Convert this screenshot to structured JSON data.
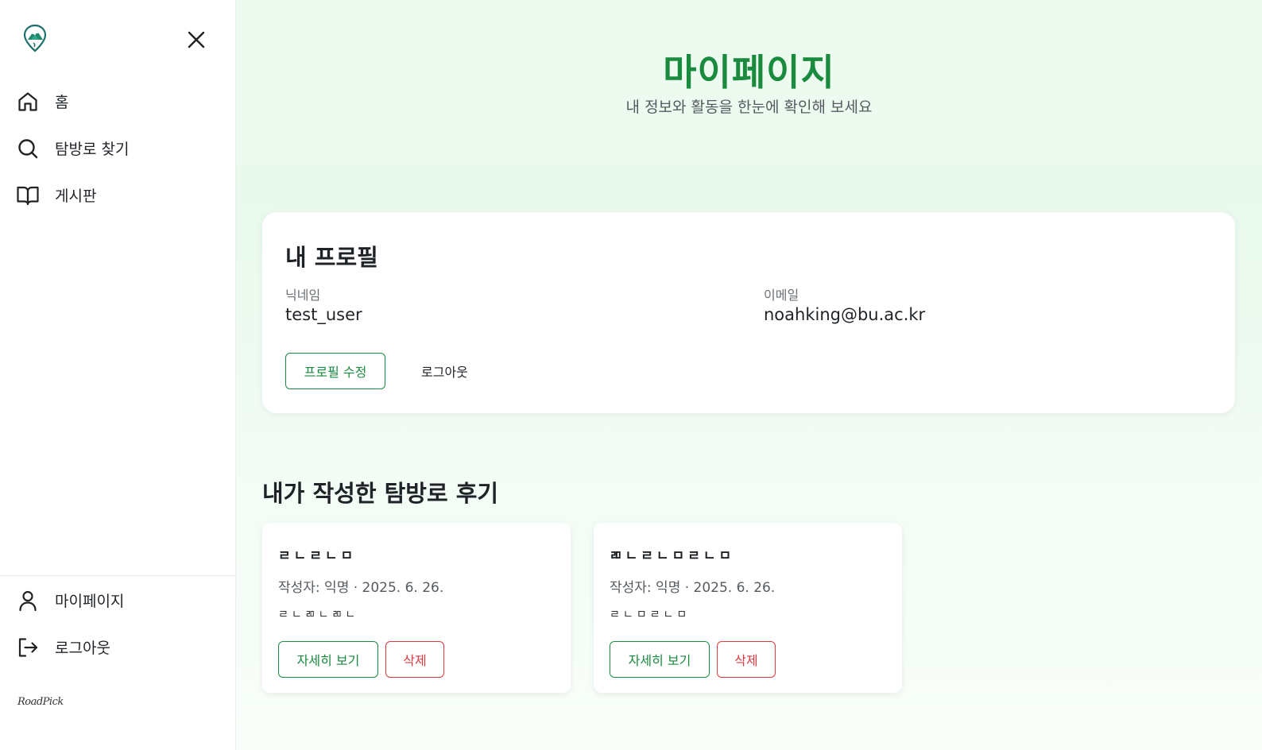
{
  "colors": {
    "accent": "#1a8a3f",
    "danger": "#e0393e",
    "hero_bg": "#ecfaf0"
  },
  "sidebar": {
    "logo_icon": "mountain-pin-logo",
    "close_icon": "close-icon",
    "items": [
      {
        "label": "홈",
        "icon": "home-icon"
      },
      {
        "label": "탐방로 찾기",
        "icon": "search-icon"
      },
      {
        "label": "게시판",
        "icon": "book-icon"
      }
    ],
    "bottom_items": [
      {
        "label": "마이페이지",
        "icon": "user-icon"
      },
      {
        "label": "로그아웃",
        "icon": "logout-icon"
      }
    ],
    "brand": "RoadPick"
  },
  "hero": {
    "title": "마이페이지",
    "subtitle": "내 정보와 활동을 한눈에 확인해 보세요"
  },
  "profile": {
    "heading": "내 프로필",
    "nickname_label": "닉네임",
    "nickname": "test_user",
    "email_label": "이메일",
    "email": "noahking@bu.ac.kr",
    "edit_button": "프로필 수정",
    "logout_button": "로그아웃"
  },
  "reviews": {
    "heading": "내가 작성한 탐방로 후기",
    "items": [
      {
        "title": "ㄹㄴㄹㄴㅁ",
        "meta": "작성자: 익명 · 2025. 6. 26.",
        "body": "ㄹㄴㄻㄴㄻㄴ",
        "detail_button": "자세히 보기",
        "delete_button": "삭제"
      },
      {
        "title": "ㄻㄴㄹㄴㅁㄹㄴㅁ",
        "meta": "작성자: 익명 · 2025. 6. 26.",
        "body": "ㄹㄴㅁㄹㄴㅁ",
        "detail_button": "자세히 보기",
        "delete_button": "삭제"
      }
    ]
  }
}
